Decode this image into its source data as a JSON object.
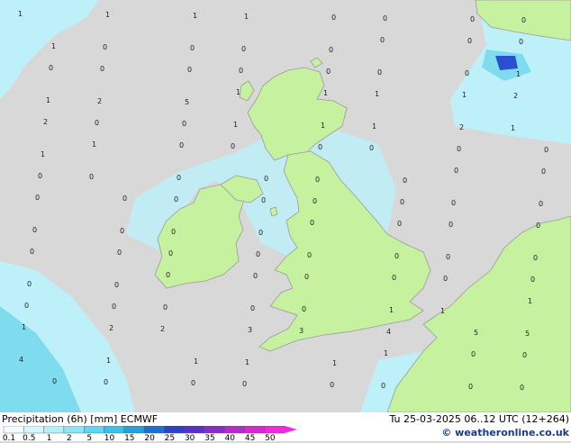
{
  "title": "Precipitation (6h) [mm] ECMWF",
  "datetime": "Tu 25-03-2025 06..12 UTC (12+264)",
  "credit": "© weatheronline.co.uk",
  "legend": {
    "labels": [
      "0.1",
      "0.5",
      "1",
      "2",
      "5",
      "10",
      "15",
      "20",
      "25",
      "30",
      "35",
      "40",
      "45",
      "50"
    ],
    "colors": [
      "#f2fcfe",
      "#d6f6fb",
      "#b8eef8",
      "#8ee4f4",
      "#5fd6ee",
      "#3bc1e6",
      "#2aa0d8",
      "#1e6fd0",
      "#2e3fc8",
      "#5a2fc8",
      "#8a2cc8",
      "#b22cc8",
      "#d42ad0",
      "#f02ae0"
    ]
  },
  "colors": {
    "sea": "#d8d8d8",
    "land": "#c6f2a0",
    "coast": "#9a9a9a",
    "precip_light": "#bdf0f8",
    "precip_mid": "#7fdcef",
    "precip_high": "#3a9ee0",
    "precip_peak": "#2b4fd0"
  },
  "map_labels": [
    "1",
    "1",
    "1",
    "1",
    "0",
    "0",
    "0",
    "0",
    "1",
    "0",
    "0",
    "0",
    "0",
    "0",
    "0",
    "0",
    "0",
    "0",
    "0",
    "0",
    "0",
    "0",
    "0",
    "1",
    "1",
    "2",
    "5",
    "1",
    "1",
    "1",
    "1",
    "2",
    "2",
    "0",
    "0",
    "1",
    "1",
    "1",
    "2",
    "1",
    "1",
    "1",
    "0",
    "0",
    "0",
    "0",
    "0",
    "0",
    "0",
    "0",
    "0",
    "0",
    "0",
    "0",
    "0",
    "0",
    "0",
    "0",
    "0",
    "0",
    "0",
    "0",
    "0",
    "0",
    "0",
    "0",
    "0",
    "0",
    "0",
    "0",
    "0",
    "0",
    "0",
    "0",
    "0",
    "0",
    "0",
    "0",
    "0",
    "0",
    "0",
    "0",
    "0",
    "0",
    "0",
    "0",
    "0",
    "0",
    "0",
    "0",
    "0",
    "0",
    "0",
    "1",
    "1",
    "1",
    "1",
    "2",
    "2",
    "3",
    "3",
    "4",
    "5",
    "5",
    "4",
    "1",
    "1",
    "1",
    "1",
    "1",
    "0",
    "0",
    "0",
    "0",
    "0",
    "0",
    "0",
    "0",
    "0",
    "0",
    "0"
  ]
}
